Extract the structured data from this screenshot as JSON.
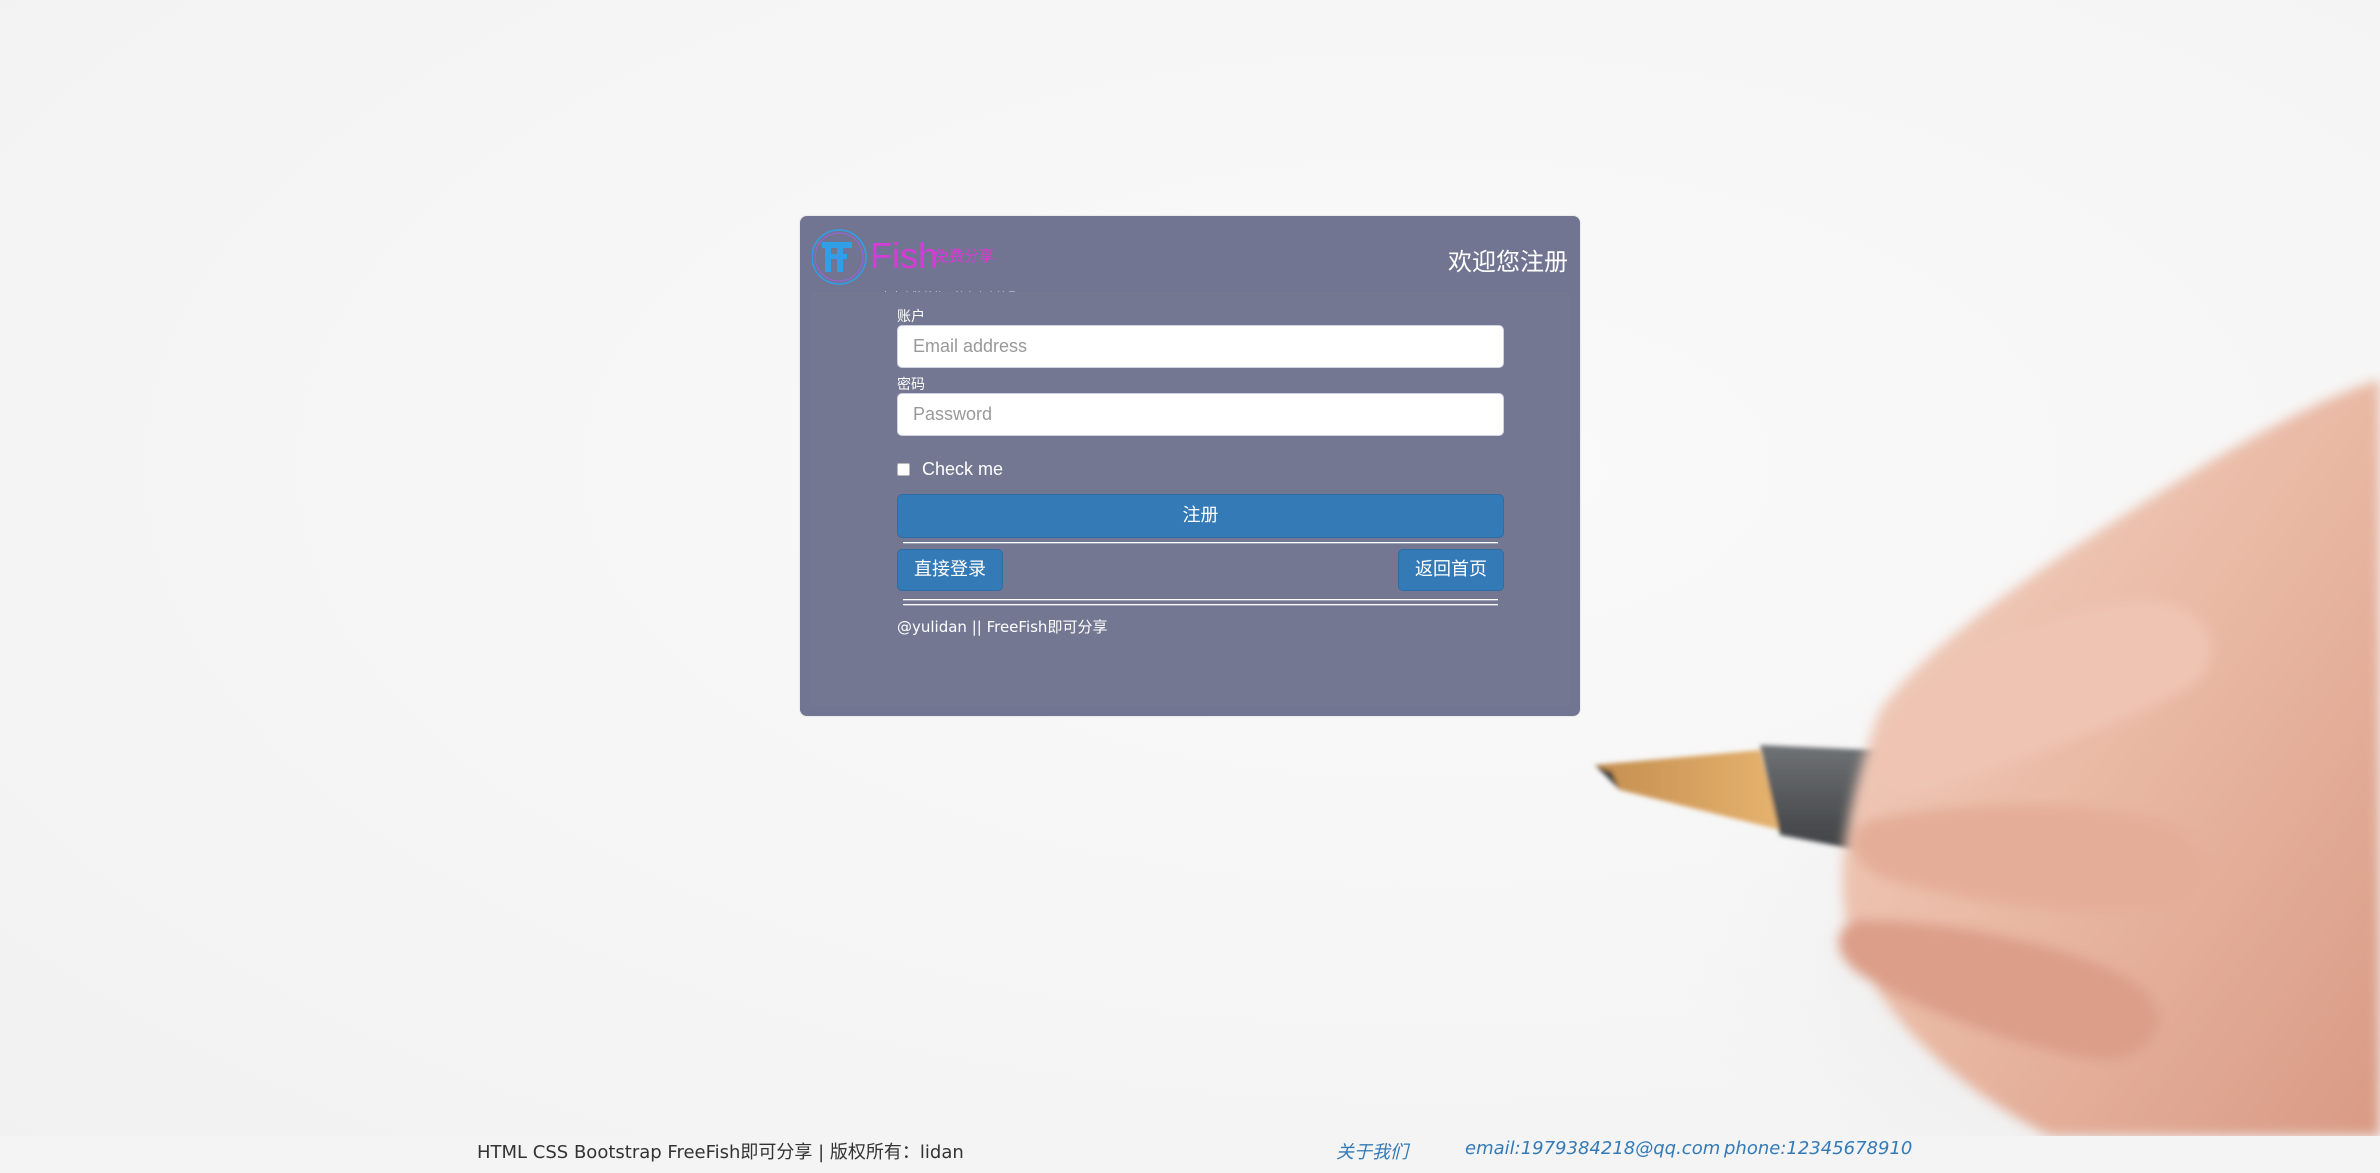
{
  "brand": {
    "logo_text": "Fish",
    "logo_subtext": "免费分享",
    "slogan": "专享大牌美妆，特享小众精品"
  },
  "header": {
    "welcome": "欢迎您注册"
  },
  "form": {
    "account_label": "账户",
    "email_placeholder": "Email address",
    "email_value": "",
    "password_label": "密码",
    "password_placeholder": "Password",
    "password_value": "",
    "check_label": "Check me",
    "checked": false,
    "submit_label": "注册",
    "login_label": "直接登录",
    "home_label": "返回首页",
    "credit": "@yulidan || FreeFish即可分享"
  },
  "footer": {
    "copyright": "HTML CSS Bootstrap FreeFish即可分享 | 版权所有：lidan",
    "about": "关于我们",
    "email": "email:1979384218@qq.com",
    "phone": "phone:12345678910"
  },
  "colors": {
    "panel": "#727591",
    "primary": "#337ab7",
    "logo_blue": "#2f9fe8",
    "logo_pink": "#d63bd8"
  },
  "icons": {
    "logo": "ff-logo-icon"
  }
}
